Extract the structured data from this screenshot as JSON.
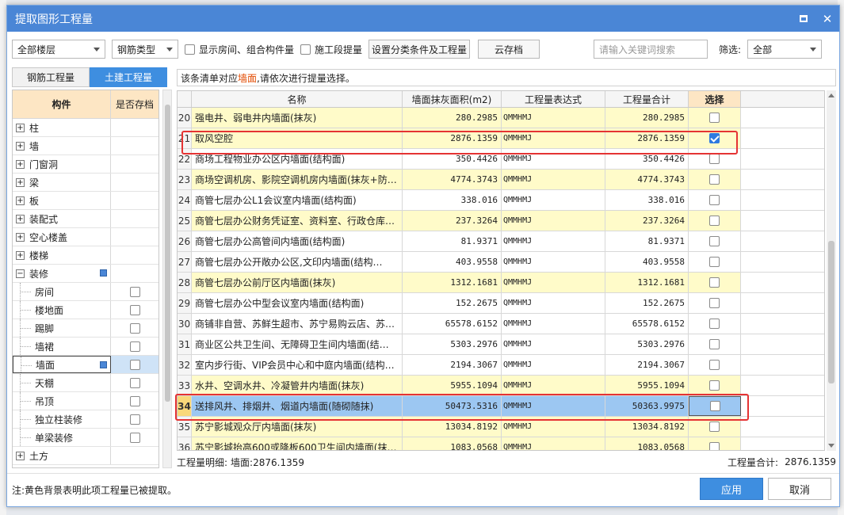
{
  "window": {
    "title": "提取图形工程量"
  },
  "toolbar": {
    "floor_select": "全部楼层",
    "rebar_select": "钢筋类型",
    "show_rooms_label": "显示房间、组合构件量",
    "stage_label": "施工段提量",
    "set_category_label": "设置分类条件及工程量",
    "cloud_save_label": "云存档",
    "search_placeholder": "请输入关键词搜索",
    "filter_label": "筛选:",
    "filter_value": "全部"
  },
  "left": {
    "tabs": [
      "钢筋工程量",
      "土建工程量"
    ],
    "col_component": "构件",
    "col_saved": "是否存档",
    "items": [
      {
        "label": "柱",
        "type": "parent",
        "expander": "+"
      },
      {
        "label": "墙",
        "type": "parent",
        "expander": "+"
      },
      {
        "label": "门窗洞",
        "type": "parent",
        "expander": "+"
      },
      {
        "label": "梁",
        "type": "parent",
        "expander": "+"
      },
      {
        "label": "板",
        "type": "parent",
        "expander": "+"
      },
      {
        "label": "装配式",
        "type": "parent",
        "expander": "+"
      },
      {
        "label": "空心楼盖",
        "type": "parent",
        "expander": "+"
      },
      {
        "label": "楼梯",
        "type": "parent",
        "expander": "+"
      },
      {
        "label": "装修",
        "type": "parent",
        "expander": "−"
      },
      {
        "label": "房间",
        "type": "child"
      },
      {
        "label": "楼地面",
        "type": "child"
      },
      {
        "label": "踢脚",
        "type": "child"
      },
      {
        "label": "墙裙",
        "type": "child"
      },
      {
        "label": "墙面",
        "type": "child"
      },
      {
        "label": "天棚",
        "type": "child"
      },
      {
        "label": "吊顶",
        "type": "child"
      },
      {
        "label": "独立柱装修",
        "type": "child"
      },
      {
        "label": "单梁装修",
        "type": "child"
      },
      {
        "label": "土方",
        "type": "parent",
        "expander": "+"
      }
    ]
  },
  "right": {
    "notice_prefix": "该条清单对应",
    "notice_highlight": "墙面",
    "notice_suffix": ",请依次进行提量选择。",
    "columns": [
      "名称",
      "墙面抹灰面积(m2)",
      "工程量表达式",
      "工程量合计",
      "选择"
    ],
    "rows": [
      {
        "num": "20",
        "name": "强电井、弱电井内墙面(抹灰)",
        "area": "280.2985",
        "expr": "QMMHMJ",
        "total": "280.2985",
        "yellow": true,
        "checked": false
      },
      {
        "num": "21",
        "name": "取风空腔",
        "area": "2876.1359",
        "expr": "QMMHMJ",
        "total": "2876.1359",
        "yellow": true,
        "checked": true
      },
      {
        "num": "22",
        "name": "商场工程物业办公区内墙面(结构面)",
        "area": "350.4426",
        "expr": "QMMHMJ",
        "total": "350.4426",
        "yellow": false,
        "checked": false
      },
      {
        "num": "23",
        "name": "商场空调机房、影院空调机房内墙面(抹灰+防…",
        "area": "4774.3743",
        "expr": "QMMHMJ",
        "total": "4774.3743",
        "yellow": true,
        "checked": false
      },
      {
        "num": "24",
        "name": "商管七层办公L1会议室内墙面(结构面)",
        "area": "338.016",
        "expr": "QMMHMJ",
        "total": "338.016",
        "yellow": false,
        "checked": false
      },
      {
        "num": "25",
        "name": "商管七层办公财务凭证室、资料室、行政仓库…",
        "area": "237.3264",
        "expr": "QMMHMJ",
        "total": "237.3264",
        "yellow": true,
        "checked": false
      },
      {
        "num": "26",
        "name": "商管七层办公高管间内墙面(结构面)",
        "area": "81.9371",
        "expr": "QMMHMJ",
        "total": "81.9371",
        "yellow": false,
        "checked": false
      },
      {
        "num": "27",
        "name": "商管七层办公开敞办公区,文印内墙面(结构…",
        "area": "403.9558",
        "expr": "QMMHMJ",
        "total": "403.9558",
        "yellow": false,
        "checked": false
      },
      {
        "num": "28",
        "name": "商管七层办公前厅区内墙面(抹灰)",
        "area": "1312.1681",
        "expr": "QMMHMJ",
        "total": "1312.1681",
        "yellow": true,
        "checked": false
      },
      {
        "num": "29",
        "name": "商管七层办公中型会议室内墙面(结构面)",
        "area": "152.2675",
        "expr": "QMMHMJ",
        "total": "152.2675",
        "yellow": false,
        "checked": false
      },
      {
        "num": "30",
        "name": "商铺非自营、苏鲜生超市、苏宁易购云店、苏…",
        "area": "65578.6152",
        "expr": "QMMHMJ",
        "total": "65578.6152",
        "yellow": false,
        "checked": false
      },
      {
        "num": "31",
        "name": "商业区公共卫生间、无障碍卫生间内墙面(结…",
        "area": "5303.2976",
        "expr": "QMMHMJ",
        "total": "5303.2976",
        "yellow": false,
        "checked": false
      },
      {
        "num": "32",
        "name": "室内步行街、VIP会员中心和中庭内墙面(结构…",
        "area": "2194.3067",
        "expr": "QMMHMJ",
        "total": "2194.3067",
        "yellow": false,
        "checked": false
      },
      {
        "num": "33",
        "name": "水井、空调水井、冷凝管井内墙面(抹灰)",
        "area": "5955.1094",
        "expr": "QMMHMJ",
        "total": "5955.1094",
        "yellow": true,
        "checked": false
      },
      {
        "num": "34",
        "name": "送排风井、排烟井、烟道内墙面(随砌随抹)",
        "area": "50473.5316",
        "expr": "QMMHMJ",
        "total": "50363.9975",
        "yellow": false,
        "selected": true,
        "checked": false
      },
      {
        "num": "35",
        "name": "苏宁影城观众厅内墙面(抹灰)",
        "area": "13034.8192",
        "expr": "QMMHMJ",
        "total": "13034.8192",
        "yellow": true,
        "checked": false
      },
      {
        "num": "36",
        "name": "苏宁影城抬高600或降板600卫生间内墙面(抹…",
        "area": "1083.0568",
        "expr": "QMMHMJ",
        "total": "1083.0568",
        "yellow": true,
        "checked": false
      }
    ],
    "detail_label": "工程量明细:",
    "detail_value": "墙面:2876.1359",
    "total_label": "工程量合计:",
    "total_value": "2876.1359"
  },
  "footer": {
    "note": "注:黄色背景表明此项工程量已被提取。",
    "apply": "应用",
    "cancel": "取消"
  },
  "colors": {
    "accent": "#3e8ee0",
    "title_bar": "#4a86d6",
    "extracted_bg": "#fffbc9",
    "selected_row": "#9cc7f2",
    "highlight_outline": "#e53333"
  }
}
